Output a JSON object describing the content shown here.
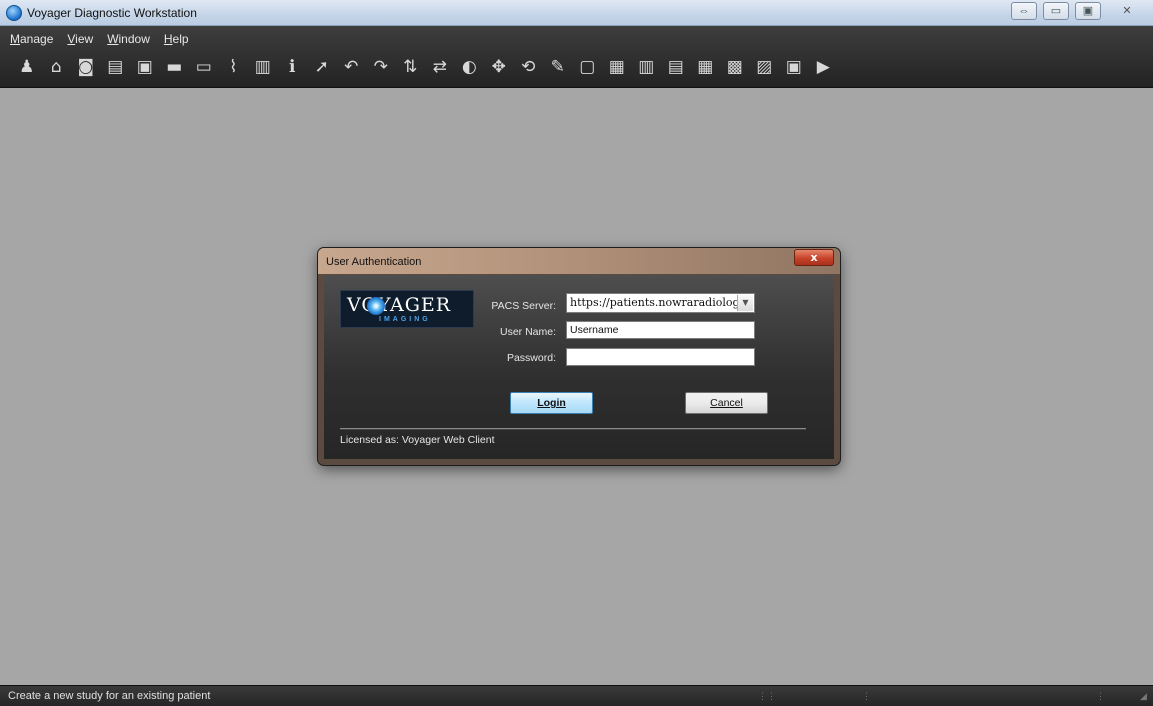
{
  "window": {
    "title": "Voyager Diagnostic Workstation"
  },
  "menu": {
    "items": [
      "Manage",
      "View",
      "Window",
      "Help"
    ]
  },
  "toolbar": {
    "icons": [
      "new-patient-icon",
      "open-folder-icon",
      "open-study-icon",
      "print-icon",
      "import-image-icon",
      "folder-icon",
      "folder-open-icon",
      "broadcast-icon",
      "save-icon",
      "info-icon",
      "select-pointer-icon",
      "rotate-left-icon",
      "rotate-right-icon",
      "flip-vertical-icon",
      "flip-horizontal-icon",
      "contrast-icon",
      "pan-icon",
      "reset-icon",
      "annotate-icon",
      "display-icon",
      "measure-icon",
      "layout-1-icon",
      "layout-2-icon",
      "layout-3-icon",
      "layout-4-icon",
      "layout-5-icon",
      "fullscreen-icon",
      "cine-icon"
    ],
    "glyphs": [
      "♟",
      "⌂",
      "◙",
      "▤",
      "▣",
      "▬",
      "▭",
      "⌇",
      "▥",
      "ℹ",
      "➚",
      "↶",
      "↷",
      "⇅",
      "⇄",
      "◐",
      "✥",
      "⟲",
      "✎",
      "▢",
      "▦",
      "▥",
      "▤",
      "▦",
      "▩",
      "▨",
      "▣",
      "▶"
    ]
  },
  "dialog": {
    "title": "User Authentication",
    "close_label": "x",
    "logo": {
      "main": "VOYAGER",
      "sub": "IMAGING"
    },
    "pacs_label": "PACS Server:",
    "pacs_value": "https://patients.nowraradiolog",
    "username_label": "User Name:",
    "username_value": "Username",
    "password_label": "Password:",
    "password_value": "",
    "login_label": "Login",
    "cancel_label": "Cancel",
    "license_text": "Licensed as: Voyager Web Client"
  },
  "status": {
    "text": "Create a new study for an existing patient"
  }
}
